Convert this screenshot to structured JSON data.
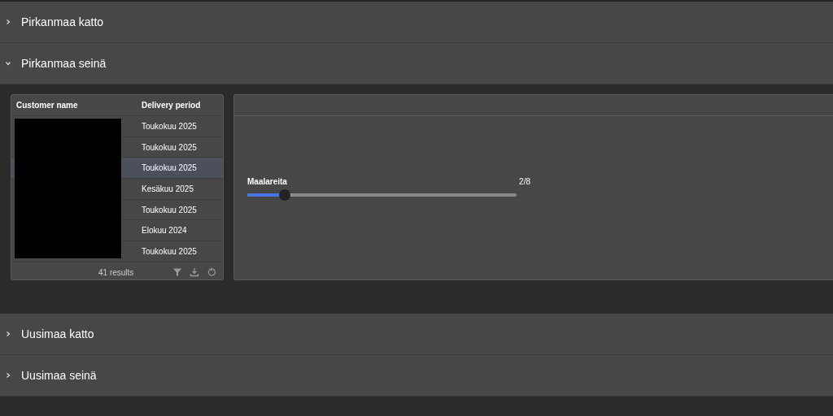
{
  "sections": [
    {
      "title": "Pirkanmaa katto",
      "expanded": false
    },
    {
      "title": "Pirkanmaa seinä",
      "expanded": true,
      "table": {
        "columns": [
          "Customer name",
          "Delivery period"
        ],
        "rows": [
          {
            "delivery_period": "Toukokuu 2025",
            "selected": false
          },
          {
            "delivery_period": "Toukokuu 2025",
            "selected": false
          },
          {
            "delivery_period": "Toukokuu 2025",
            "selected": true
          },
          {
            "delivery_period": "Kesäkuu 2025",
            "selected": false
          },
          {
            "delivery_period": "Toukokuu 2025",
            "selected": false
          },
          {
            "delivery_period": "Elokuu 2024",
            "selected": false
          },
          {
            "delivery_period": "Toukokuu 2025",
            "selected": false
          }
        ],
        "results": "41 results"
      },
      "slider": {
        "label": "Maalareita",
        "reading": "2/8",
        "level": 0.14
      }
    },
    {
      "title": "Uusimaa katto",
      "expanded": false
    },
    {
      "title": "Uusimaa seinä",
      "expanded": false
    }
  ]
}
